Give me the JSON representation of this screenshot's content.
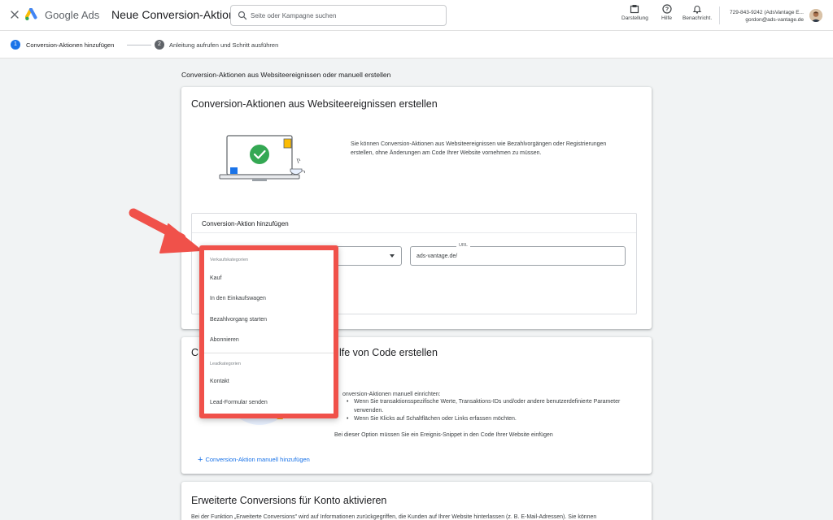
{
  "header": {
    "brand": "Google Ads",
    "title": "Neue Conversion-Aktion",
    "search_placeholder": "Seite oder Kampagne suchen",
    "actions": [
      "Darstellung",
      "Hilfe",
      "Benachricht."
    ],
    "account_id": "729-843-9242 (AdsVantage E...",
    "account_email": "gordon@ads-vantage.de",
    "brand_colors": {
      "blue": "#4285f4",
      "yellow": "#fbbc04",
      "green": "#34a853"
    }
  },
  "stepper": {
    "steps": [
      {
        "number": "1",
        "label": "Conversion-Aktionen hinzufügen",
        "active": true
      },
      {
        "number": "2",
        "label": "Anleitung aufrufen und Schritt ausführen",
        "active": false
      }
    ],
    "active_color": "#1a73e8",
    "inactive_color": "#5f6368"
  },
  "main": {
    "heading": "Conversion-Aktionen aus Websiteereignissen oder manuell erstellen",
    "card1": {
      "title": "Conversion-Aktionen aus Websiteereignissen erstellen",
      "description": "Sie können Conversion-Aktionen aus Websiteereignissen wie Bezahlvorgängen oder Registrierungen erstellen, ohne Änderungen am Code Ihrer Website vornehmen zu müssen.",
      "panel_title": "Conversion-Aktion hinzufügen",
      "url_label": "URL",
      "url_value": "ads-vantage.de/"
    },
    "card2": {
      "title_prefix": "C",
      "title_suffix": "lfe von Code erstellen",
      "intro": "onversion-Aktionen manuell einrichten:",
      "bullet1": "Wenn Sie transaktionsspezifische Werte, Transaktions-IDs und/oder andere benutzerdefinierte Parameter verwenden.",
      "bullet2": "Wenn Sie Klicks auf Schaltflächen oder Links erfassen möchten.",
      "snippet_note": "Bei dieser Option müssen Sie ein Ereignis-Snippet in den Code Ihrer Website einfügen",
      "manual_link": "Conversion-Aktion manuell hinzufügen"
    },
    "card3": {
      "title": "Erweiterte Conversions für Konto aktivieren",
      "text": "Bei der Funktion „Erweiterte Conversions\" wird auf Informationen zurückgegriffen, die Kunden auf Ihrer Website hinterlassen (z. B. E-Mail-Adressen). Sie können"
    }
  },
  "dropdown": {
    "group1": "Verkaufskategorien",
    "group1_items": [
      "Kauf",
      "In den Einkaufswagen",
      "Bezahlvorgang starten",
      "Abonnieren"
    ],
    "group2": "Leadkategorien",
    "group2_items": [
      "Kontakt",
      "Lead-Formular senden"
    ],
    "highlight_color": "#f0514a"
  }
}
